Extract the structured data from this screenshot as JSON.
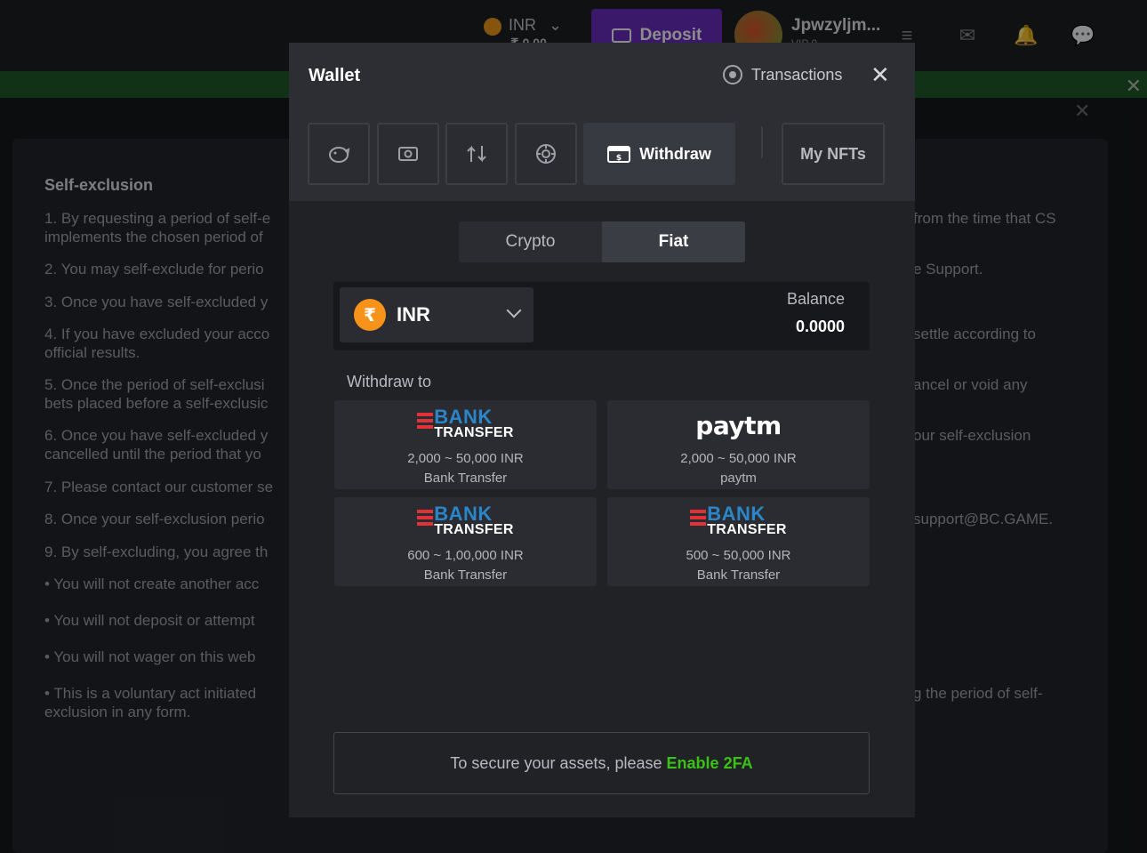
{
  "header": {
    "currency": "INR",
    "balance": "₹ 0.00",
    "deposit_label": "Deposit",
    "username": "Jpwzyljm...",
    "vip": "VIP 0"
  },
  "background": {
    "heading": "Self-exclusion",
    "left_lines": [
      "1. By requesting a period of self-e",
      "implements the chosen period of",
      "2. You may self-exclude for perio",
      "3. Once you have self-excluded y",
      "4. If you have excluded your acco",
      "official results.",
      "5. Once the period of self-exclusi",
      "bets placed before a self-exclusic",
      "6. Once you have self-excluded y",
      "cancelled until the period that yo",
      "7. Please contact our customer se",
      "8. Once your self-exclusion perio",
      "9. By self-excluding, you agree th",
      "•  You will not create another acc",
      "•  You will not deposit or attempt",
      "•  You will not wager on this web",
      "•  This is a voluntary act initiated",
      "   exclusion in any form."
    ],
    "right_lines": [
      "from the time that CS",
      "e Support.",
      "settle according to",
      "ancel or void any",
      "our self-exclusion",
      "support@BC.GAME.",
      "g the period of self-"
    ]
  },
  "wallet": {
    "title": "Wallet",
    "transactions_label": "Transactions",
    "withdraw_label": "Withdraw",
    "nfts_label": "My NFTs",
    "tabs": [
      "Crypto",
      "Fiat"
    ],
    "active_tab": "Fiat",
    "currency": "INR",
    "currency_symbol": "₹",
    "balance_label": "Balance",
    "balance_value": "0.0000",
    "withdraw_to_label": "Withdraw to",
    "methods": [
      {
        "logo_top": "BANK",
        "logo_bottom": "TRANSFER",
        "range": "2,000 ~ 50,000 INR",
        "name": "Bank Transfer"
      },
      {
        "logo_text": "paytm",
        "range": "2,000 ~ 50,000 INR",
        "name": "paytm"
      },
      {
        "logo_top": "BANK",
        "logo_bottom": "TRANSFER",
        "range": "600 ~ 1,00,000 INR",
        "name": "Bank Transfer"
      },
      {
        "logo_top": "BANK",
        "logo_bottom": "TRANSFER",
        "range": "500 ~ 50,000 INR",
        "name": "Bank Transfer"
      }
    ],
    "secure_text": "To secure your assets, please",
    "secure_link": "Enable 2FA"
  },
  "colors": {
    "accent_green": "#3bc117",
    "deposit_purple": "#6b2fc4",
    "coin_orange": "#f7931a",
    "bank_red": "#e13337",
    "bank_blue": "#2a86c8"
  }
}
